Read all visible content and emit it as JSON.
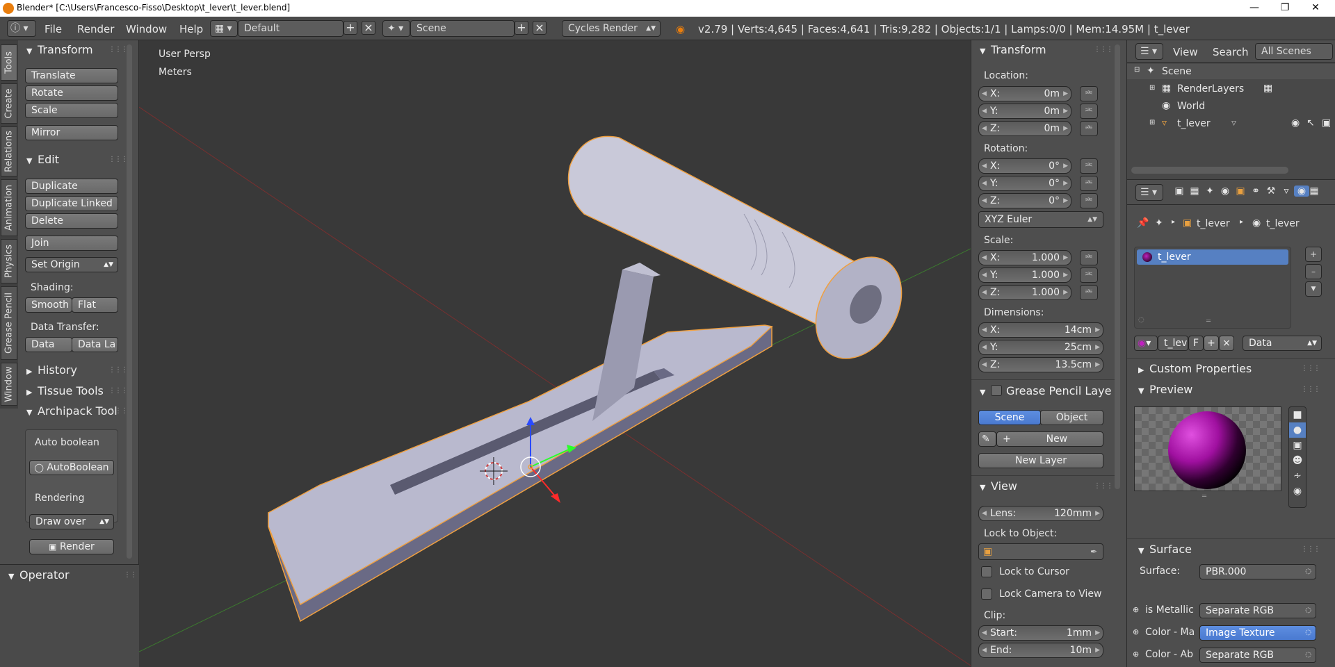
{
  "window": {
    "title": "Blender* [C:\\Users\\Francesco-Fisso\\Desktop\\t_lever\\t_lever.blend]"
  },
  "info_bar": {
    "menus": [
      "File",
      "Render",
      "Window",
      "Help"
    ],
    "screen_layout": "Default",
    "scene": "Scene",
    "render_engine": "Cycles Render",
    "stats": "v2.79 | Verts:4,645 | Faces:4,641 | Tris:9,282 | Objects:1/1 | Lamps:0/0 | Mem:14.95M | t_lever"
  },
  "tool_tabs": [
    "Tools",
    "Create",
    "Relations",
    "Animation",
    "Physics",
    "Grease Pencil",
    "Window"
  ],
  "tool_shelf": {
    "transform": {
      "title": "Transform",
      "buttons": [
        "Translate",
        "Rotate",
        "Scale",
        "Mirror"
      ]
    },
    "edit": {
      "title": "Edit",
      "buttons": [
        "Duplicate",
        "Duplicate Linked",
        "Delete",
        "Join"
      ],
      "set_origin": "Set Origin",
      "shading_label": "Shading:",
      "shading_buttons": [
        "Smooth",
        "Flat"
      ],
      "data_transfer_label": "Data Transfer:",
      "data_transfer_buttons": [
        "Data",
        "Data La"
      ]
    },
    "collapsed": [
      "History",
      "Tissue Tools"
    ],
    "archipack": {
      "title": "Archipack Tools",
      "auto_boolean_label": "Auto boolean",
      "auto_boolean_button": "AutoBoolean",
      "rendering_label": "Rendering",
      "draw_mode": "Draw over",
      "render_button": "Render"
    },
    "operator": "Operator"
  },
  "viewport": {
    "view_name": "User Persp",
    "units": "Meters"
  },
  "n_panel": {
    "transform": {
      "title": "Transform",
      "location_label": "Location:",
      "location": [
        {
          "k": "X:",
          "v": "0m"
        },
        {
          "k": "Y:",
          "v": "0m"
        },
        {
          "k": "Z:",
          "v": "0m"
        }
      ],
      "rotation_label": "Rotation:",
      "rotation": [
        {
          "k": "X:",
          "v": "0°"
        },
        {
          "k": "Y:",
          "v": "0°"
        },
        {
          "k": "Z:",
          "v": "0°"
        }
      ],
      "rotation_mode": "XYZ Euler",
      "scale_label": "Scale:",
      "scale": [
        {
          "k": "X:",
          "v": "1.000"
        },
        {
          "k": "Y:",
          "v": "1.000"
        },
        {
          "k": "Z:",
          "v": "1.000"
        }
      ],
      "dimensions_label": "Dimensions:",
      "dimensions": [
        {
          "k": "X:",
          "v": "14cm"
        },
        {
          "k": "Y:",
          "v": "25cm"
        },
        {
          "k": "Z:",
          "v": "13.5cm"
        }
      ]
    },
    "grease_pencil": {
      "title": "Grease Pencil Layer",
      "tabs": [
        "Scene",
        "Object"
      ],
      "new_button": "New",
      "new_layer_button": "New Layer"
    },
    "view": {
      "title": "View",
      "lens_label": "Lens:",
      "lens_value": "120mm",
      "lock_to_object_label": "Lock to Object:",
      "lock_to_cursor": "Lock to Cursor",
      "lock_camera": "Lock Camera to View",
      "clip_label": "Clip:",
      "clip_start_label": "Start:",
      "clip_start": "1mm",
      "clip_end_label": "End:",
      "clip_end": "10m"
    }
  },
  "outliner": {
    "menus": [
      "View",
      "Search"
    ],
    "filter": "All Scenes",
    "items": [
      "Scene",
      "RenderLayers",
      "World",
      "t_lever"
    ]
  },
  "properties": {
    "breadcrumb": [
      "t_lever",
      "t_lever"
    ],
    "material_slot": "t_lever",
    "material_name": "t_lev",
    "fake_user": "F",
    "link_mode": "Data",
    "custom_properties": "Custom Properties",
    "preview": "Preview",
    "surface": {
      "title": "Surface",
      "surface_label": "Surface:",
      "surface_value": "PBR.000",
      "rows": [
        {
          "label": "is Metallic",
          "value": "Separate RGB"
        },
        {
          "label": "Color - Ma",
          "value": "Image Texture"
        },
        {
          "label": "Color - Ab",
          "value": "Separate RGB"
        }
      ]
    }
  },
  "colors": {
    "selection": "#5680c2",
    "outline": "#f0a040",
    "material": "#c020c0"
  }
}
